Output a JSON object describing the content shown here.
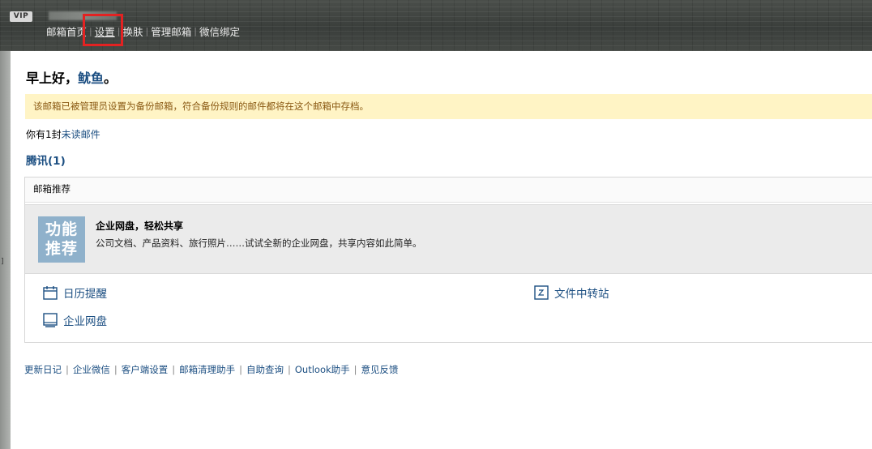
{
  "header": {
    "vip_badge": "VIP",
    "nav": [
      {
        "label": "邮箱首页",
        "name": "nav-home"
      },
      {
        "label": "设置",
        "name": "nav-settings",
        "active": true
      },
      {
        "label": "换肤",
        "name": "nav-skin"
      },
      {
        "label": "管理邮箱",
        "name": "nav-manage"
      },
      {
        "label": "微信绑定",
        "name": "nav-wechat"
      }
    ]
  },
  "greeting": {
    "prefix": "早上好，",
    "user": "鱿鱼",
    "suffix": "。"
  },
  "notice": "该邮箱已被管理员设置为备份邮箱，符合备份规则的邮件都将在这个邮箱中存档。",
  "unread": {
    "prefix": "你有1封",
    "link": "未读邮件"
  },
  "group_label": "腾讯(1)",
  "recommend": {
    "header": "邮箱推荐",
    "badge_line1": "功能",
    "badge_line2": "推荐",
    "title": "企业网盘，轻松共享",
    "desc": "公司文档、产品资料、旅行照片……试试全新的企业网盘，共享内容如此简单。",
    "tools": {
      "calendar": "日历提醒",
      "transfer": "文件中转站",
      "disk": "企业网盘"
    }
  },
  "footer_links": [
    "更新日记",
    "企业微信",
    "客户端设置",
    "邮箱清理助手",
    "自助查询",
    "Outlook助手",
    "意见反馈"
  ],
  "colors": {
    "link": "#1c4f82",
    "notice_bg": "#fff4c5",
    "highlight": "#e32222"
  }
}
